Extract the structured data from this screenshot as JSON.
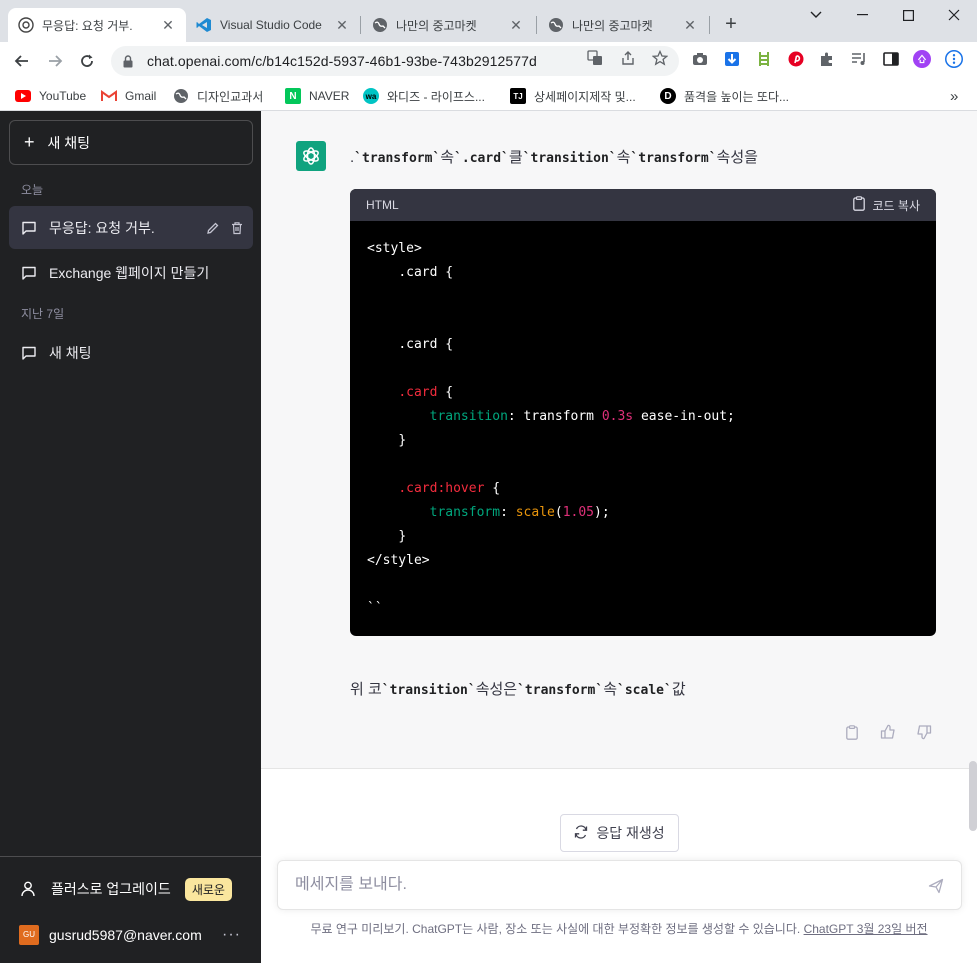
{
  "browser": {
    "tabs": [
      {
        "title": "무응답: 요청 거부.",
        "icon": "chatgpt-icon",
        "active": true
      },
      {
        "title": "Visual Studio Code",
        "icon": "vscode-icon",
        "active": false
      },
      {
        "title": "나만의 중고마켓",
        "icon": "globe-icon",
        "active": false
      },
      {
        "title": "나만의 중고마켓",
        "icon": "globe-icon",
        "active": false
      }
    ],
    "new_tab": "+",
    "url": "chat.openai.com/c/b14c152d-5937-46b1-93be-743b2912577d",
    "bookmarks": [
      {
        "label": "YouTube",
        "icon": "youtube-icon"
      },
      {
        "label": "Gmail",
        "icon": "gmail-icon"
      },
      {
        "label": "디자인교과서",
        "icon": "globe-icon"
      },
      {
        "label": "NAVER",
        "icon": "naver-icon",
        "glyph": "N"
      },
      {
        "label": "와디즈 - 라이프스...",
        "icon": "wadiz-icon",
        "glyph": "wa"
      },
      {
        "label": "상세페이지제작 및...",
        "icon": "tj-icon",
        "glyph": "TJ"
      },
      {
        "label": "품격을 높이는 또다...",
        "icon": "d-icon",
        "glyph": "D"
      }
    ],
    "bookmarks_overflow": "»"
  },
  "sidebar": {
    "new_chat": "새 채팅",
    "section_today": "오늘",
    "section_last7": "지난 7일",
    "today_items": [
      {
        "label": "무응답: 요청 거부."
      },
      {
        "label": "Exchange 웹페이지 만들기"
      }
    ],
    "last7_items": [
      {
        "label": "새 채팅"
      }
    ],
    "upgrade": "플러스로 업그레이드",
    "upgrade_badge": "새로운",
    "user_initials": "GU",
    "user_email": "gusrud5987@naver.com",
    "more": "···"
  },
  "chat": {
    "intro": {
      "p1": ".",
      "c1": "`transform`",
      "p2": "속",
      "c2": "`.card`",
      "p3": "클",
      "c3": "`transition`",
      "p4": "속",
      "c4": "`transform`",
      "p5": "속성을"
    },
    "code": {
      "language": "HTML",
      "copy_label": "코드 복사",
      "l1": "<style>",
      "l2_sel": ".card {",
      "l3_sel": ".card {",
      "l4_sel": ".card",
      "l4_rest": " {",
      "l5_prop": "transition",
      "l5_a": ": transform ",
      "l5_num": "0.3s",
      "l5_b": " ease-in-out;",
      "l6": "}",
      "l7_sel": ".card:hover",
      "l7_rest": " {",
      "l8_prop": "transform",
      "l8_a": ": ",
      "l8_fn": "scale",
      "l8_b": "(",
      "l8_num": "1.05",
      "l8_c": ");",
      "l9": "}",
      "l10": "</style>",
      "l11": "``"
    },
    "outro": {
      "p1": "위 코",
      "c1": "`transition`",
      "p2": "속성은",
      "c2": "`transform`",
      "p3": "속",
      "c3": "`scale`",
      "p4": "값"
    },
    "regenerate": "응답 재생성",
    "input_placeholder": "메세지를 보내다.",
    "disclaimer": "무료 연구 미리보기. ChatGPT는 사람, 장소 또는 사실에 대한 부정확한 정보를 생성할 수 있습니다. ",
    "disclaimer_link": "ChatGPT 3월 23일 버전"
  },
  "colors": {
    "sidebar_bg": "#202123",
    "accent_green": "#10a37f",
    "code_selector": "#f22c3d",
    "code_property": "#00a67d",
    "code_number": "#df3079",
    "code_function": "#e9950c"
  }
}
